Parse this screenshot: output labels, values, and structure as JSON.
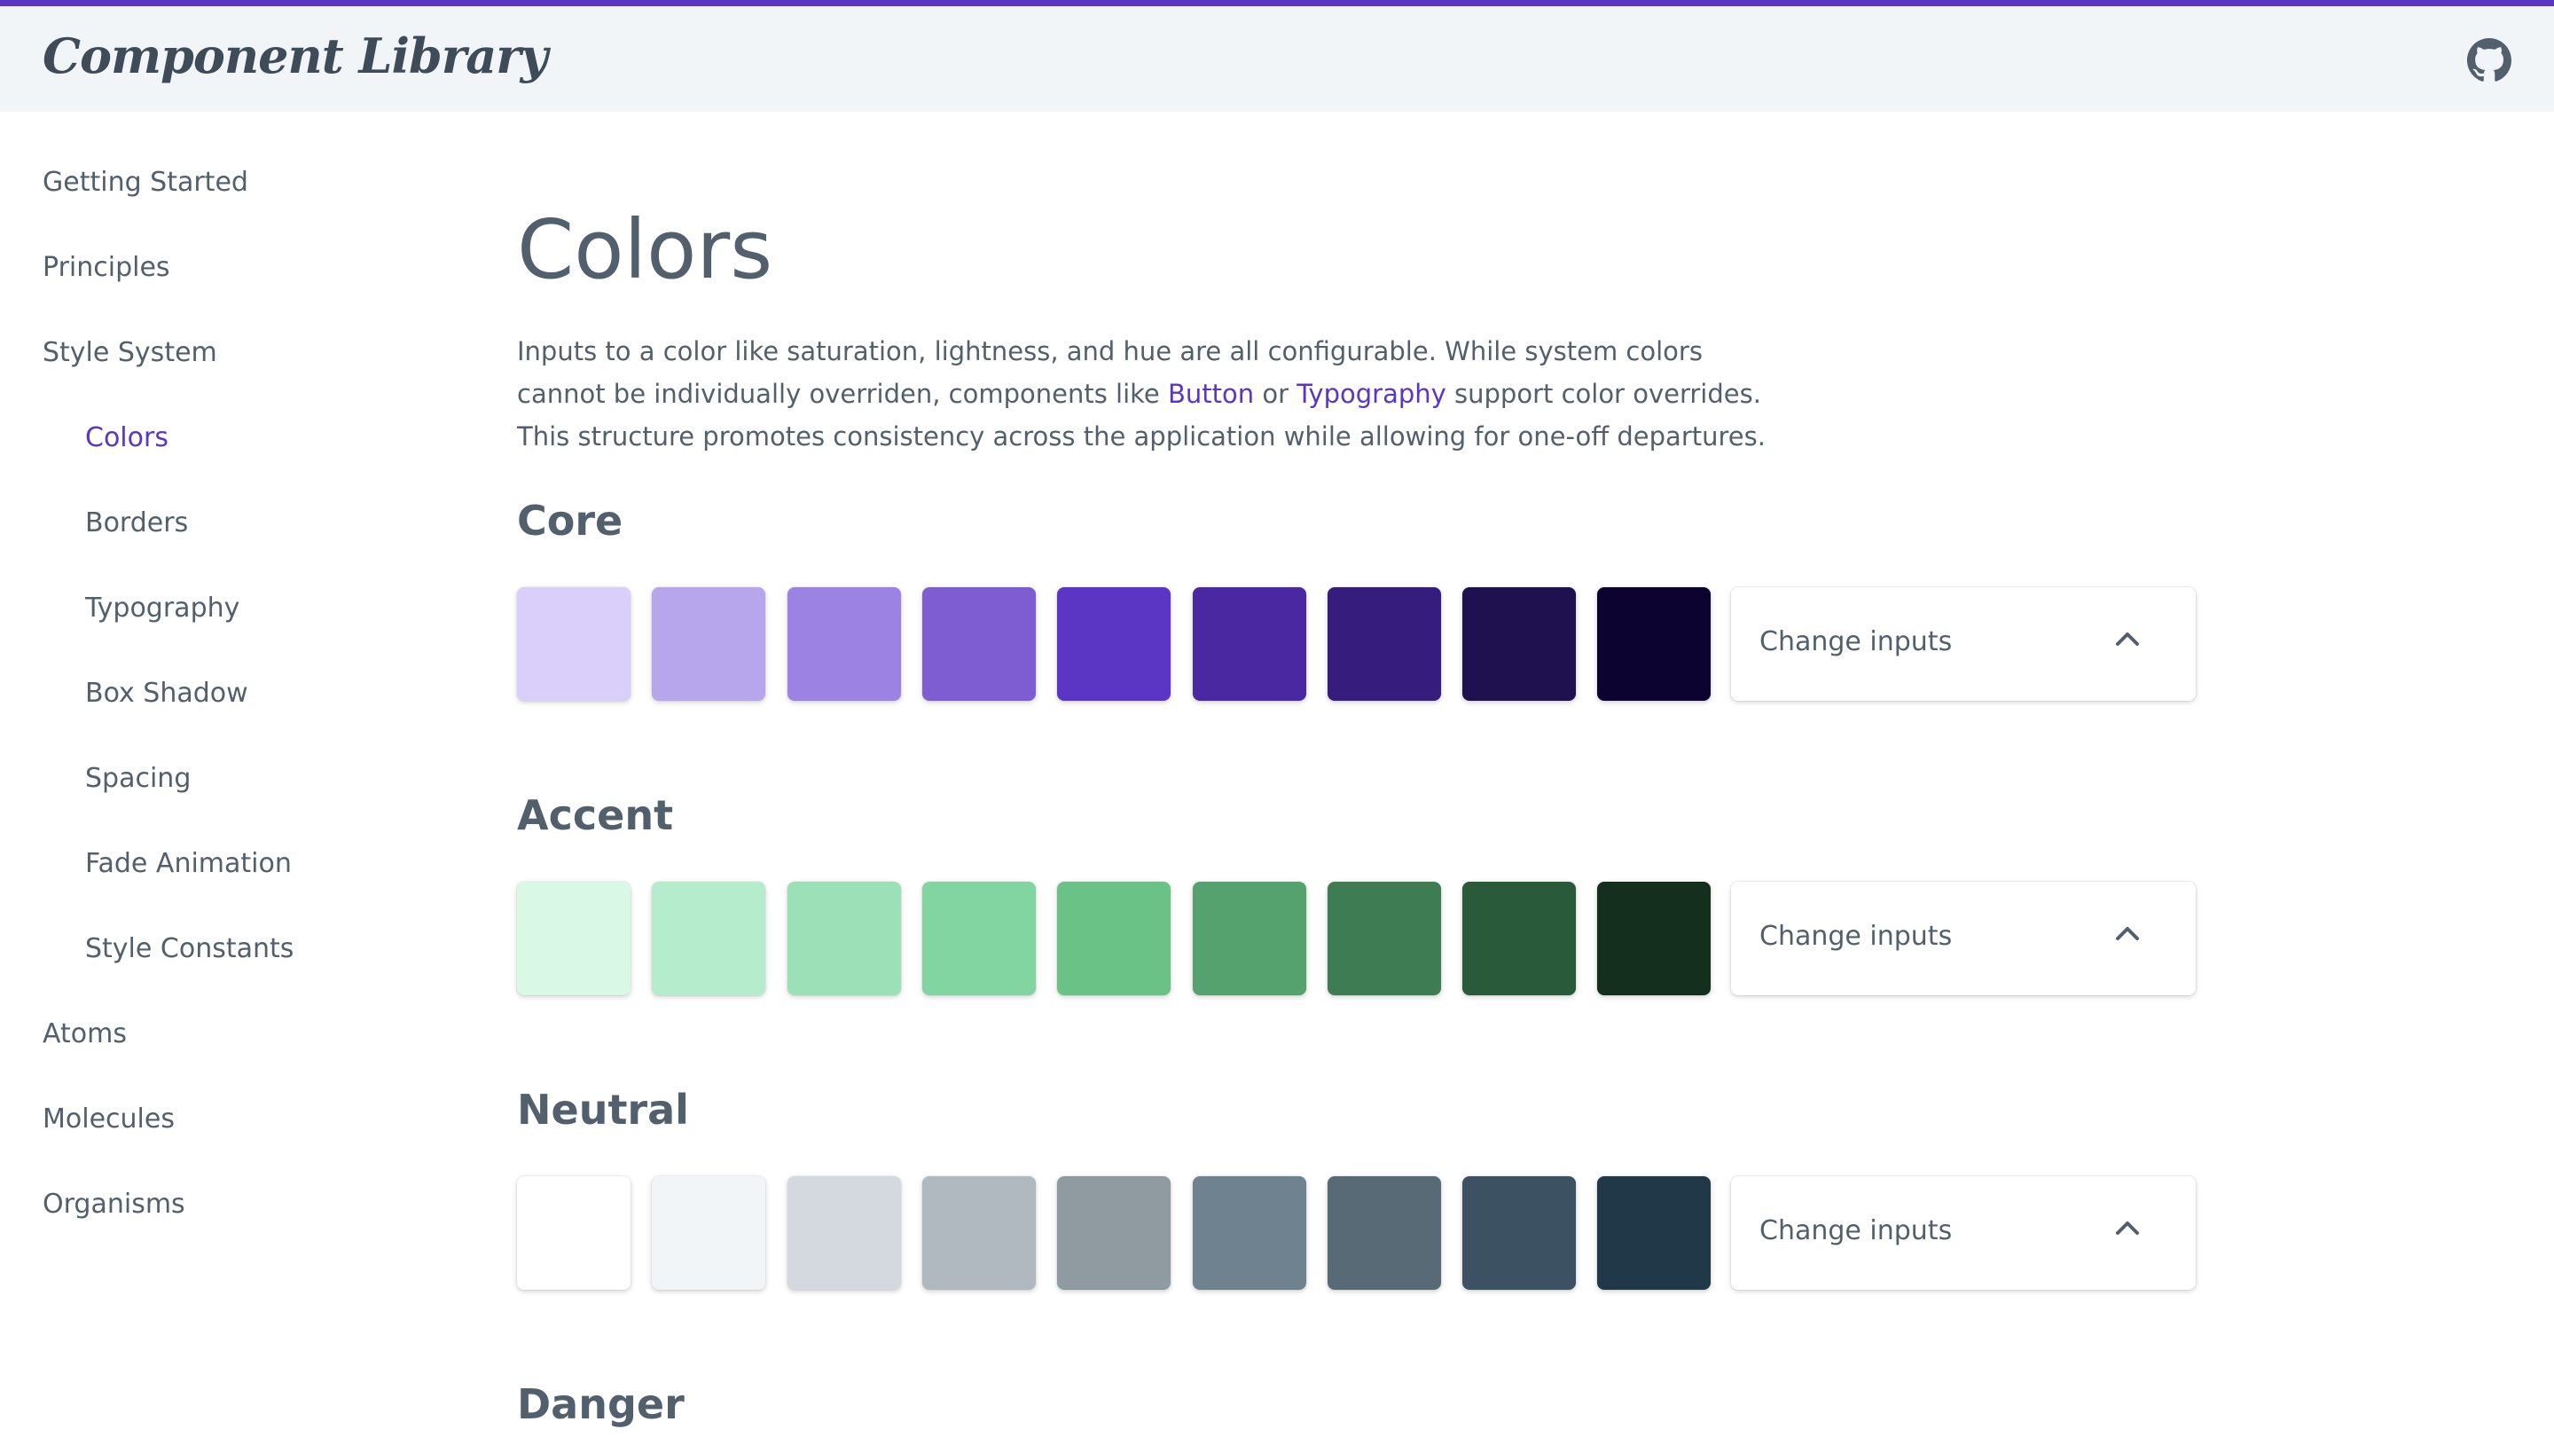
{
  "header": {
    "brand": "Component Library",
    "github_icon": "github-icon"
  },
  "sidebar": {
    "items": [
      {
        "label": "Getting Started"
      },
      {
        "label": "Principles"
      },
      {
        "label": "Style System"
      },
      {
        "label": "Colors",
        "active": true
      },
      {
        "label": "Borders"
      },
      {
        "label": "Typography"
      },
      {
        "label": "Box Shadow"
      },
      {
        "label": "Spacing"
      },
      {
        "label": "Fade Animation"
      },
      {
        "label": "Style Constants"
      },
      {
        "label": "Atoms"
      },
      {
        "label": "Molecules"
      },
      {
        "label": "Organisms"
      }
    ]
  },
  "main": {
    "title": "Colors",
    "intro": {
      "part1": "Inputs to a color like saturation, lightness, and hue are all configurable. While system colors cannot be individually overriden, components like ",
      "link1": "Button",
      "part2": " or ",
      "link2": "Typography",
      "part3": " support color overrides. This structure promotes consistency across the application while allowing for one-off departures."
    },
    "sections": [
      {
        "title": "Core",
        "change_label": "Change inputs",
        "swatches": [
          "#dacffa",
          "#b8a6ec",
          "#9c82e2",
          "#7e5cd2",
          "#5b35c4",
          "#4a28a2",
          "#361c7c",
          "#1f104f",
          "#0d0330"
        ]
      },
      {
        "title": "Accent",
        "change_label": "Change inputs",
        "swatches": [
          "#d9f9e6",
          "#b5edcc",
          "#9ce0b8",
          "#82d4a0",
          "#6bc287",
          "#55a26e",
          "#3e7d53",
          "#295a3a",
          "#142f1d"
        ]
      },
      {
        "title": "Neutral",
        "change_label": "Change inputs",
        "swatches": [
          "#ffffff",
          "#f2f5f8",
          "#d3d9df",
          "#b0b9bf",
          "#8f9aa1",
          "#6f828f",
          "#596a77",
          "#3c5162",
          "#213849"
        ]
      },
      {
        "title": "Danger"
      }
    ]
  },
  "colors": {
    "accent": "#5b35c4",
    "text": "#52606d",
    "header_bg": "#f2f5f8"
  }
}
